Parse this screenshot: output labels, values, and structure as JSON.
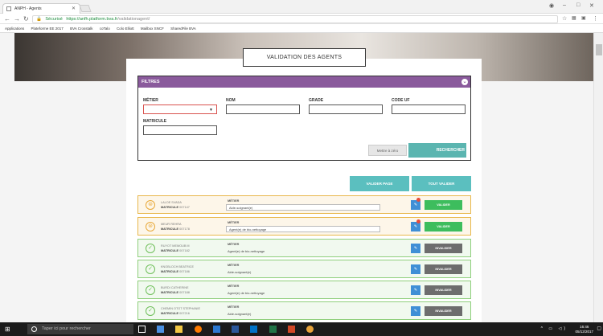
{
  "browser": {
    "tab_title": "ANPH - Agents",
    "secure_label": "Sécurisé",
    "url_host": "https://anfh.platform.bva.fr",
    "url_path": "/validationagent/",
    "bookmarks": [
      "Applications",
      "Plateforme EE 2017",
      "BVA Crosstalk",
      "coTalo",
      "Colo Elliott",
      "Mailbox SNCF",
      "SharedFile BVA"
    ]
  },
  "page": {
    "title": "VALIDATION DES AGENTS",
    "filters": {
      "header": "FILTRES",
      "metier_label": "MÉTIER",
      "nom_label": "NOM",
      "grade_label": "GRADE",
      "code_uf_label": "CODE UF",
      "matricule_label": "MATRICULE",
      "reset_label": "Mettre à zéro",
      "search_label": "RECHERCHER"
    },
    "validate_page_label": "VALIDER PAGE",
    "validate_all_label": "TOUT VALIDER",
    "field_metier": "MÉTIER",
    "field_matricule": "MATRICULE",
    "agents": [
      {
        "status": "pending",
        "name": "LALOE SVADA",
        "matricule": "007147",
        "metier": "Aide-soignant(e)",
        "action": "VALIDER"
      },
      {
        "status": "pending",
        "name": "MEUR REHRA",
        "matricule": "007178",
        "metier": "Agent(e) de bio-nettoyage",
        "action": "VALIDER"
      },
      {
        "status": "valid",
        "name": "RUYOT MEMOUB M",
        "matricule": "007182",
        "metier": "Agent(e) de bio-nettoyage",
        "action": "INVALIDER"
      },
      {
        "status": "valid",
        "name": "KNOBLOCH BEATRICE",
        "matricule": "007186",
        "metier": "Aide-soignant(e)",
        "action": "INVALIDER"
      },
      {
        "status": "valid",
        "name": "BURDI CATHERINE",
        "matricule": "007188",
        "metier": "Agent(e) de bio-nettoyage",
        "action": "INVALIDER"
      },
      {
        "status": "valid",
        "name": "CHEMIN OTOT STEPHANIE",
        "matricule": "007216",
        "metier": "Aide-soignant(e)",
        "action": "INVALIDER"
      }
    ]
  },
  "taskbar": {
    "search_placeholder": "Taper ici pour rechercher",
    "time": "16:46",
    "date": "05/12/2017"
  }
}
